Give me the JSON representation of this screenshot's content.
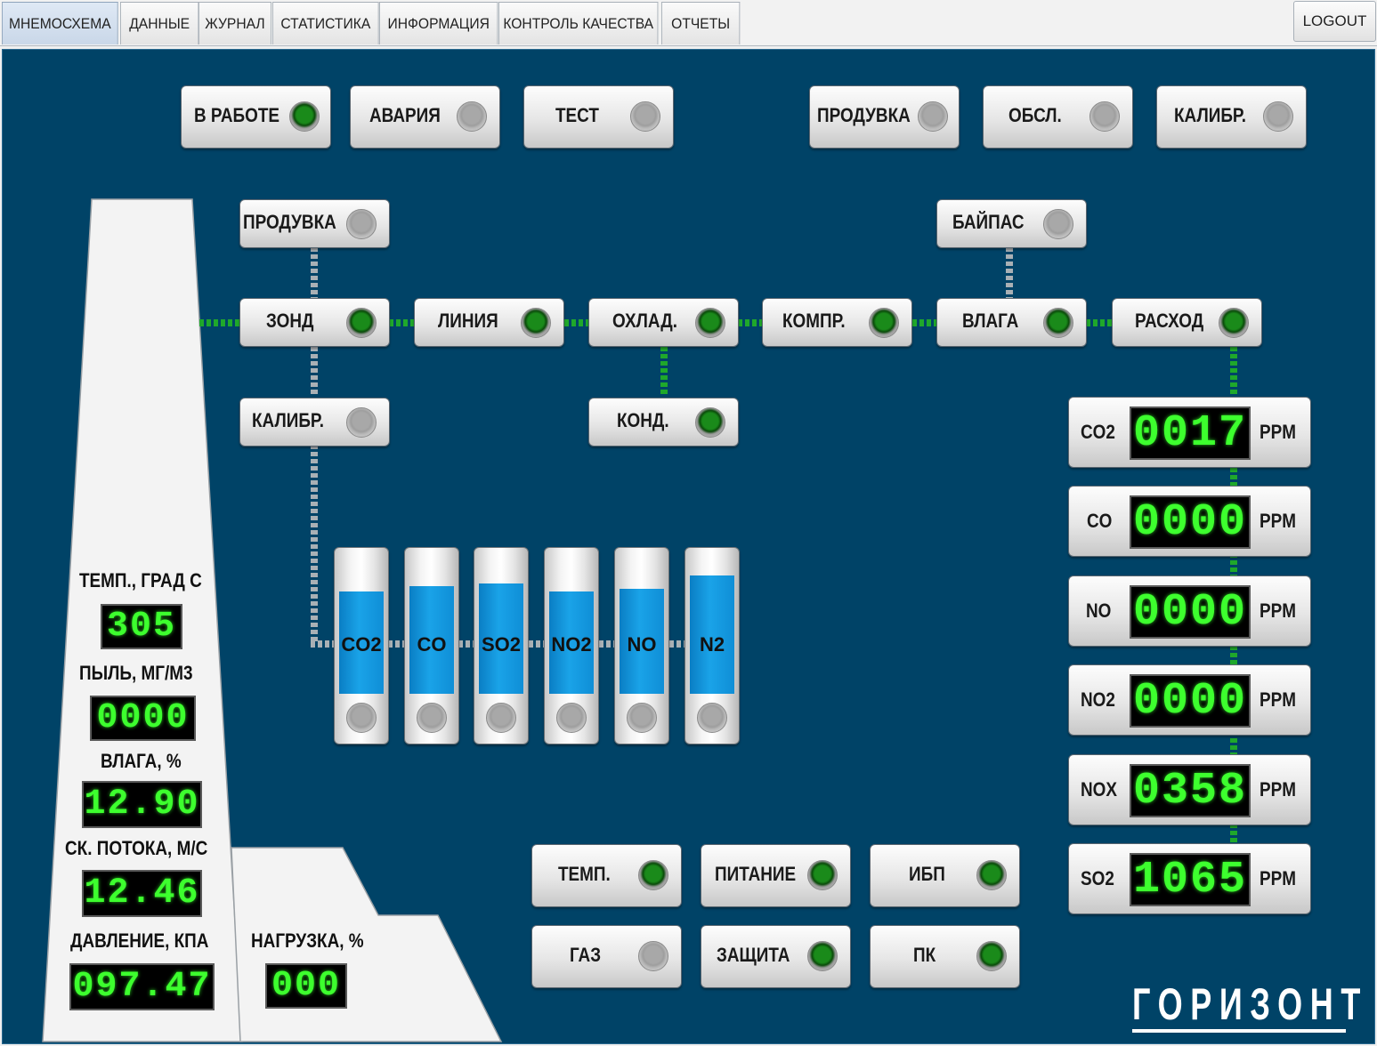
{
  "tabs": [
    {
      "label": "МНЕМОСХЕМА",
      "active": true
    },
    {
      "label": "ДАННЫЕ"
    },
    {
      "label": "ЖУРНАЛ"
    },
    {
      "label": "СТАТИСТИКА"
    },
    {
      "label": "ИНФОРМАЦИЯ"
    },
    {
      "label": "КОНТРОЛЬ КАЧЕСТВА"
    },
    {
      "label": "ОТЧЕТЫ"
    }
  ],
  "logout_label": "LOGOUT",
  "status_top": [
    {
      "label": "В РАБОТЕ",
      "state": "on"
    },
    {
      "label": "АВАРИЯ",
      "state": "off"
    },
    {
      "label": "ТЕСТ",
      "state": "off"
    },
    {
      "label": "ПРОДУВКА",
      "state": "off"
    },
    {
      "label": "ОБСЛ.",
      "state": "off"
    },
    {
      "label": "КАЛИБР.",
      "state": "off"
    }
  ],
  "flow": {
    "purge": {
      "label": "ПРОДУВКА",
      "state": "off"
    },
    "bypass": {
      "label": "БАЙПАС",
      "state": "off"
    },
    "probe": {
      "label": "ЗОНД",
      "state": "on"
    },
    "line": {
      "label": "ЛИНИЯ",
      "state": "on"
    },
    "cooler": {
      "label": "ОХЛАД.",
      "state": "on"
    },
    "compressor": {
      "label": "КОМПР.",
      "state": "on"
    },
    "moisture": {
      "label": "ВЛАГА",
      "state": "on"
    },
    "flowrate": {
      "label": "РАСХОД",
      "state": "on"
    },
    "calib": {
      "label": "КАЛИБР.",
      "state": "off"
    },
    "condensate": {
      "label": "КОНД.",
      "state": "on"
    }
  },
  "gas_cylinders": [
    {
      "label": "CO2",
      "level": 0.78
    },
    {
      "label": "CO",
      "level": 0.82
    },
    {
      "label": "SO2",
      "level": 0.84
    },
    {
      "label": "NO2",
      "level": 0.78
    },
    {
      "label": "NO",
      "level": 0.8
    },
    {
      "label": "N2",
      "level": 0.9
    }
  ],
  "analyzers": [
    {
      "gas": "CO2",
      "value": "0017",
      "unit": "PPM"
    },
    {
      "gas": "CO",
      "value": "0000",
      "unit": "PPM"
    },
    {
      "gas": "NO",
      "value": "0000",
      "unit": "PPM"
    },
    {
      "gas": "NO2",
      "value": "0000",
      "unit": "PPM"
    },
    {
      "gas": "NOX",
      "value": "0358",
      "unit": "PPM"
    },
    {
      "gas": "SO2",
      "value": "1065",
      "unit": "PPM"
    }
  ],
  "stack": {
    "temp": {
      "label": "ТЕМП., ГРАД С",
      "value": "305"
    },
    "dust": {
      "label": "ПЫЛЬ, МГ/М3",
      "value": "0000"
    },
    "moisture": {
      "label": "ВЛАГА, %",
      "value": "12.90"
    },
    "velocity": {
      "label": "СК. ПОТОКА, М/С",
      "value": "12.46"
    },
    "pressure": {
      "label": "ДАВЛЕНИЕ, КПА",
      "value": "097.47"
    },
    "load": {
      "label": "НАГРУЗКА, %",
      "value": "000"
    }
  },
  "system_status": [
    {
      "label": "ТЕМП.",
      "state": "on"
    },
    {
      "label": "ПИТАНИЕ",
      "state": "on"
    },
    {
      "label": "ИБП",
      "state": "on"
    },
    {
      "label": "ГАЗ",
      "state": "off"
    },
    {
      "label": "ЗАЩИТА",
      "state": "on"
    },
    {
      "label": "ПК",
      "state": "on"
    }
  ],
  "brand": "ГОРИЗОНТ"
}
